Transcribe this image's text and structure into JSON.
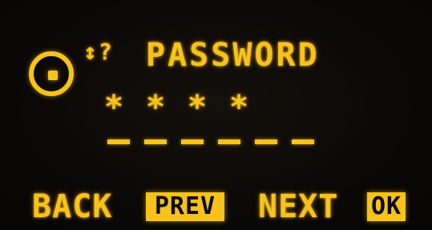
{
  "header": {
    "prompt_glyph": "↕?",
    "title": "PASSWORD"
  },
  "entry": {
    "masked_digits": [
      "*",
      "*",
      "*",
      "*"
    ],
    "slot_count": 6,
    "mask_char": "_"
  },
  "softkeys": {
    "back_label": "BACK",
    "prev_label": "PREV",
    "next_label": "NEXT",
    "ok_label": "OK"
  },
  "colors": {
    "display_text": "#f7c21a",
    "background": "#0b0907"
  },
  "icons": {
    "lock": "lock-ring-icon"
  }
}
